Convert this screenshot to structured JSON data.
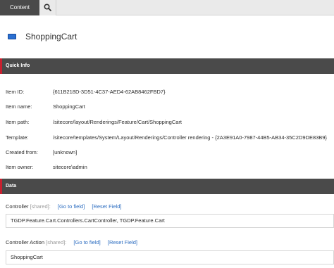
{
  "tabs": {
    "content_label": "Content"
  },
  "item": {
    "title": "ShoppingCart"
  },
  "quick_info": {
    "section_title": "Quick Info",
    "rows": [
      {
        "label": "Item ID:",
        "value": "{611B218D-3D51-4C37-AED4-62AB8462FBD7}"
      },
      {
        "label": "Item name:",
        "value": "ShoppingCart"
      },
      {
        "label": "Item path:",
        "value": "/sitecore/layout/Renderings/Feature/Cart/ShoppingCart"
      },
      {
        "label": "Template:",
        "value": "/sitecore/templates/System/Layout/Renderings/Controller rendering - {2A3E91A0-7987-44B5-AB34-35C2D9DE83B9}"
      },
      {
        "label": "Created from:",
        "value": "[unknown]"
      },
      {
        "label": "Item owner:",
        "value": "sitecore\\admin"
      }
    ]
  },
  "data_section": {
    "section_title": "Data",
    "fields": [
      {
        "label": "Controller",
        "shared": "[shared]:",
        "goto": "[Go to field]",
        "reset": "[Reset Field]",
        "value": "TGDP.Feature.Cart.Controllers.CartController, TGDP.Feature.Cart"
      },
      {
        "label": "Controller Action",
        "shared": "[shared]:",
        "goto": "[Go to field]",
        "reset": "[Reset Field]",
        "value": "ShoppingCart"
      }
    ]
  },
  "colors": {
    "section_bar": "#4a4a4a",
    "section_accent": "#c8202f",
    "link": "#2b6cc0",
    "item_icon": "#2a6fd1"
  }
}
